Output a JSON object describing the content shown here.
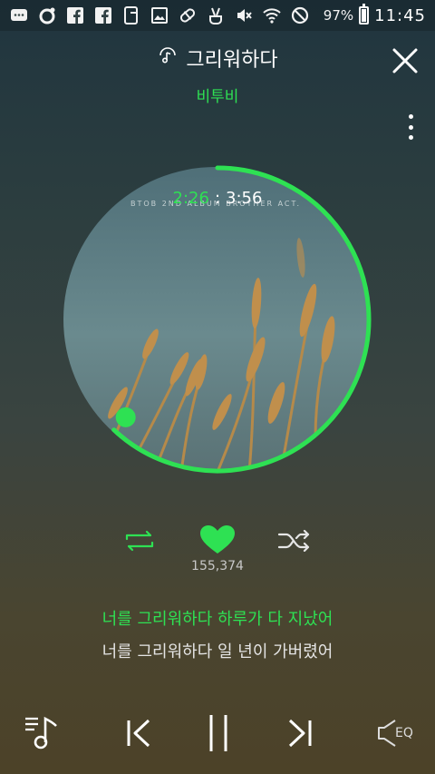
{
  "status_bar": {
    "icons": [
      "message-icon",
      "record-icon",
      "facebook-icon",
      "facebook-icon",
      "phone-icon",
      "image-icon",
      "pill-icon",
      "peace-icon",
      "mute-icon",
      "wifi-icon",
      "block-icon"
    ],
    "battery_percent": "97%",
    "battery_level": 0.97,
    "time": "11:45"
  },
  "header": {
    "title": "그리워하다",
    "artist": "비투비"
  },
  "player": {
    "album_caption": "BTOB 2ND ALBUM   BROTHER ACT.",
    "current_time": "2:26",
    "separator": ":",
    "total_time": "3:56",
    "progress": 0.62,
    "accent_color": "#2ee153"
  },
  "actions": {
    "likes_count": "155,374"
  },
  "lyrics": {
    "current_line": "너를 그리워하다 하루가 다 지났어",
    "next_line": "너를 그리워하다 일 년이 가버렸어"
  },
  "bottom_bar": {
    "eq_label": "EQ"
  }
}
